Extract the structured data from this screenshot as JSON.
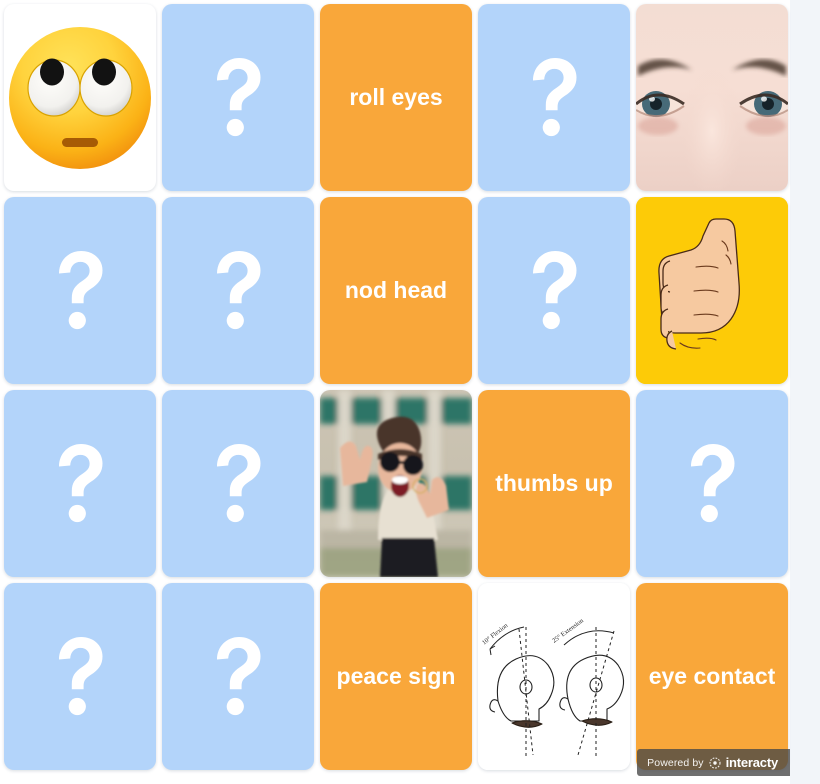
{
  "game": {
    "type": "memory-match-grid",
    "columns": 5,
    "rows": 4,
    "colors": {
      "page_background": "#f2f5f9",
      "board_background": "#ffffff",
      "card_back": "#b3d4fa",
      "card_word": "#f9a73a",
      "card_word_text": "#ffffff",
      "card_yellow": "#fdcb07",
      "badge_background": "#464646"
    }
  },
  "cards": [
    {
      "id": "c1",
      "kind": "image",
      "art": "rolling-eyes-emoji",
      "label": ""
    },
    {
      "id": "c2",
      "kind": "back",
      "art": "question-mark",
      "label": ""
    },
    {
      "id": "c3",
      "kind": "word",
      "art": "",
      "label": "roll eyes"
    },
    {
      "id": "c4",
      "kind": "back",
      "art": "question-mark",
      "label": ""
    },
    {
      "id": "c5",
      "kind": "image",
      "art": "eyes-closeup-photo",
      "label": ""
    },
    {
      "id": "c6",
      "kind": "back",
      "art": "question-mark",
      "label": ""
    },
    {
      "id": "c7",
      "kind": "back",
      "art": "question-mark",
      "label": ""
    },
    {
      "id": "c8",
      "kind": "word",
      "art": "",
      "label": "nod head"
    },
    {
      "id": "c9",
      "kind": "back",
      "art": "question-mark",
      "label": ""
    },
    {
      "id": "c10",
      "kind": "yellow",
      "art": "thumbs-up-hand",
      "label": ""
    },
    {
      "id": "c11",
      "kind": "back",
      "art": "question-mark",
      "label": ""
    },
    {
      "id": "c12",
      "kind": "back",
      "art": "question-mark",
      "label": ""
    },
    {
      "id": "c13",
      "kind": "image",
      "art": "peace-sign-woman-photo",
      "label": ""
    },
    {
      "id": "c14",
      "kind": "word",
      "art": "",
      "label": "thumbs up"
    },
    {
      "id": "c15",
      "kind": "back",
      "art": "question-mark",
      "label": ""
    },
    {
      "id": "c16",
      "kind": "back",
      "art": "question-mark",
      "label": ""
    },
    {
      "id": "c17",
      "kind": "back",
      "art": "question-mark",
      "label": ""
    },
    {
      "id": "c18",
      "kind": "word",
      "art": "",
      "label": "peace sign"
    },
    {
      "id": "c19",
      "kind": "image",
      "art": "head-flexion-extension-diagram",
      "label": ""
    },
    {
      "id": "c20",
      "kind": "word",
      "art": "",
      "label": "eye contact"
    }
  ],
  "diagram_labels": {
    "left": "10° Flexion",
    "right": "25° Extension"
  },
  "badge": {
    "powered_by": "Powered by",
    "brand": "interacty"
  }
}
